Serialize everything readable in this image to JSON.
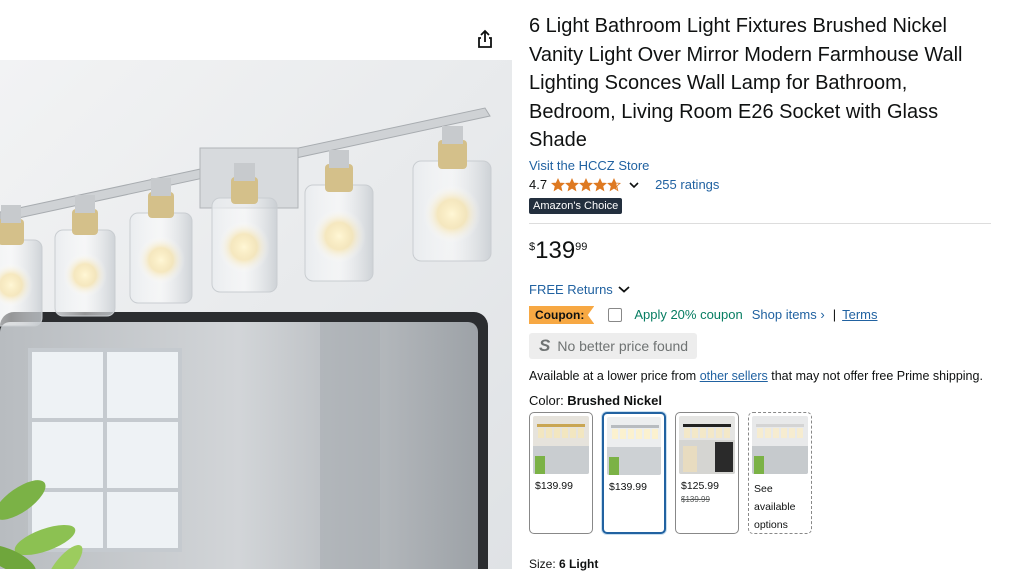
{
  "share": {
    "icon": "share-icon"
  },
  "product": {
    "title": "6 Light Bathroom Light Fixtures Brushed Nickel Vanity Light Over Mirror Modern Farmhouse Wall Lighting Sconces Wall Lamp for Bathroom, Bedroom, Living Room E26 Socket with Glass Shade",
    "store_link": "Visit the HCCZ Store",
    "rating_value": "4.7",
    "rating_stars": 4.7,
    "ratings_count": "255 ratings",
    "badge": "Amazon's Choice"
  },
  "price": {
    "symbol": "$",
    "whole": "139",
    "fraction": "99"
  },
  "returns": {
    "label": "FREE Returns"
  },
  "coupon": {
    "badge": "Coupon:",
    "apply_text": "Apply 20% coupon",
    "shop_items": "Shop items ›",
    "separator": "|",
    "terms": "Terms"
  },
  "no_better_price": {
    "icon_letter": "S",
    "text": "No better price found"
  },
  "availability": {
    "prefix": "Available at a lower price from ",
    "link": "other sellers",
    "suffix": " that may not offer free Prime shipping."
  },
  "color": {
    "label": "Color: ",
    "selected": "Brushed Nickel",
    "options": [
      {
        "price": "$139.99",
        "selected": false
      },
      {
        "price": "$139.99",
        "selected": true
      },
      {
        "price": "$125.99",
        "list_price": "$139.99",
        "selected": false
      },
      {
        "see_text": "See available options",
        "selected": false
      }
    ]
  },
  "size": {
    "label": "Size: ",
    "selected": "6 Light"
  },
  "colors": {
    "link": "#2162A1",
    "star": "#DE7921",
    "coupon": "#F7A843",
    "badge_bg": "#232F3E",
    "coupon_text": "#067D62"
  }
}
